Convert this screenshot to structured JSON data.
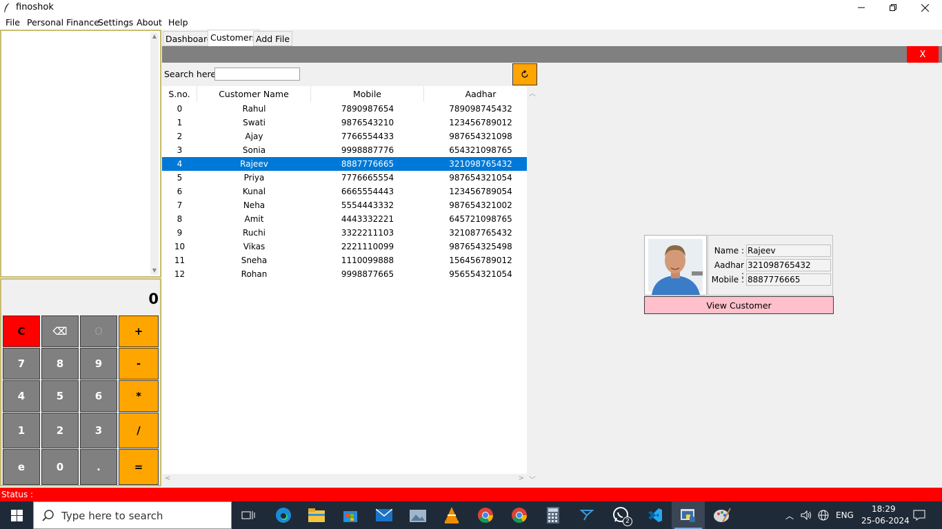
{
  "window": {
    "title": "finoshok"
  },
  "menu": [
    "File",
    "Personal Finance",
    "Settings",
    "About",
    "Help"
  ],
  "calculator": {
    "display": "0",
    "buttons": [
      [
        "C",
        "⌫",
        "O",
        "+"
      ],
      [
        "7",
        "8",
        "9",
        "-"
      ],
      [
        "4",
        "5",
        "6",
        "*"
      ],
      [
        "1",
        "2",
        "3",
        "/"
      ],
      [
        "e",
        "0",
        ".",
        "="
      ]
    ]
  },
  "tabs": [
    "Dashboard",
    "Customers",
    "Add File"
  ],
  "active_tab": "Customers",
  "close_label": "X",
  "search": {
    "label": "Search here :",
    "value": ""
  },
  "refresh_glyph": "⟳",
  "table": {
    "headers": [
      "S.no.",
      "Customer Name",
      "Mobile",
      "Aadhar"
    ],
    "selected_index": 4,
    "rows": [
      [
        "0",
        "Rahul",
        "7890987654",
        "789098745432"
      ],
      [
        "1",
        "Swati",
        "9876543210",
        "123456789012"
      ],
      [
        "2",
        "Ajay",
        "7766554433",
        "987654321098"
      ],
      [
        "3",
        "Sonia",
        "9998887776",
        "654321098765"
      ],
      [
        "4",
        "Rajeev",
        "8887776665",
        "321098765432"
      ],
      [
        "5",
        "Priya",
        "7776665554",
        "987654321054"
      ],
      [
        "6",
        "Kunal",
        "6665554443",
        "123456789054"
      ],
      [
        "7",
        "Neha",
        "5554443332",
        "987654321002"
      ],
      [
        "8",
        "Amit",
        "4443332221",
        "645721098765"
      ],
      [
        "9",
        "Ruchi",
        "3322211103",
        "321087765432"
      ],
      [
        "10",
        "Vikas",
        "2221110099",
        "987654325498"
      ],
      [
        "11",
        "Sneha",
        "1110099888",
        "156456789012"
      ],
      [
        "12",
        "Rohan",
        "9998877665",
        "956554321054"
      ]
    ]
  },
  "customer_card": {
    "name_label": "Name :",
    "name": "Rajeev",
    "aadhar_label": "Aadhar :",
    "aadhar": "321098765432",
    "mobile_label": "Mobile :",
    "mobile": "8887776665",
    "view_button": "View Customer"
  },
  "status": {
    "label": "Status :"
  },
  "taskbar": {
    "search_placeholder": "Type here to search",
    "whatsapp_badge": "2",
    "language": "ENG",
    "time": "18:29",
    "date": "25-06-2024"
  },
  "colors": {
    "calc_clear": "#ff0000",
    "calc_operator": "#ffa500",
    "calc_digit": "#808080",
    "selected_row": "#0078d7",
    "status_bar": "#ff0000",
    "view_button": "#ffc0cb"
  }
}
